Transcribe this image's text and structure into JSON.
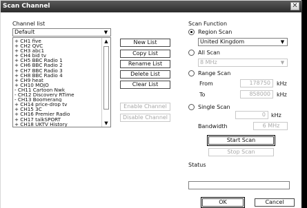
{
  "window": {
    "title": "Scan Channel",
    "close_glyph": "✕"
  },
  "channel_list": {
    "label": "Channel list",
    "selected": "Default",
    "items": [
      "+ CH1 five",
      "+ CH2 QVC",
      "+ CH3 abc1",
      "+ CH4 bid tv",
      "+ CH5 BBC Radio 1",
      "+ CH6 BBC Radio 2",
      "+ CH7 BBC Radio 3",
      "+ CH8 BBC Radio 4",
      "+ CH9 heat",
      "+ CH10 MOJO",
      "- CH11 Cartoon Nwk",
      "- CH12 Discovery RTime",
      "- CH13 Boomerang",
      "+ CH14 price-drop tv",
      "+ CH15 3C",
      "+ CH16 Premier Radio",
      "+ CH17 talkSPORT",
      "+ CH18 UKTV History"
    ]
  },
  "buttons": {
    "new_list": "New List",
    "copy_list": "Copy List",
    "rename_list": "Rename List",
    "delete_list": "Delete List",
    "clear_list": "Clear List",
    "enable_channel": "Enable Channel",
    "disable_channel": "Disable Channel"
  },
  "scan_function": {
    "label": "Scan Function",
    "region_scan": {
      "label": "Region Scan",
      "selected_region": "United Kingdom",
      "checked": true
    },
    "all_scan": {
      "label": "All Scan",
      "bandwidth": "8 MHz"
    },
    "range_scan": {
      "label": "Range Scan",
      "from_label": "From",
      "from_value": "178750",
      "from_unit": "kHz",
      "to_label": "To",
      "to_value": "858000",
      "to_unit": "kHz"
    },
    "single_scan": {
      "label": "Single Scan",
      "value": "0",
      "unit": "kHz",
      "bandwidth_label": "Bandwidth",
      "bandwidth_value": "6 MHz"
    },
    "start_scan": "Start Scan",
    "stop_scan": "Stop Scan"
  },
  "status": {
    "label": "Status",
    "text": ""
  },
  "footer": {
    "ok": "OK",
    "cancel": "Cancel"
  },
  "icons": {
    "dropdown": "chevron-down-icon",
    "scroll_up": "scroll-up-arrow-icon",
    "scroll_down": "scroll-down-arrow-icon"
  }
}
